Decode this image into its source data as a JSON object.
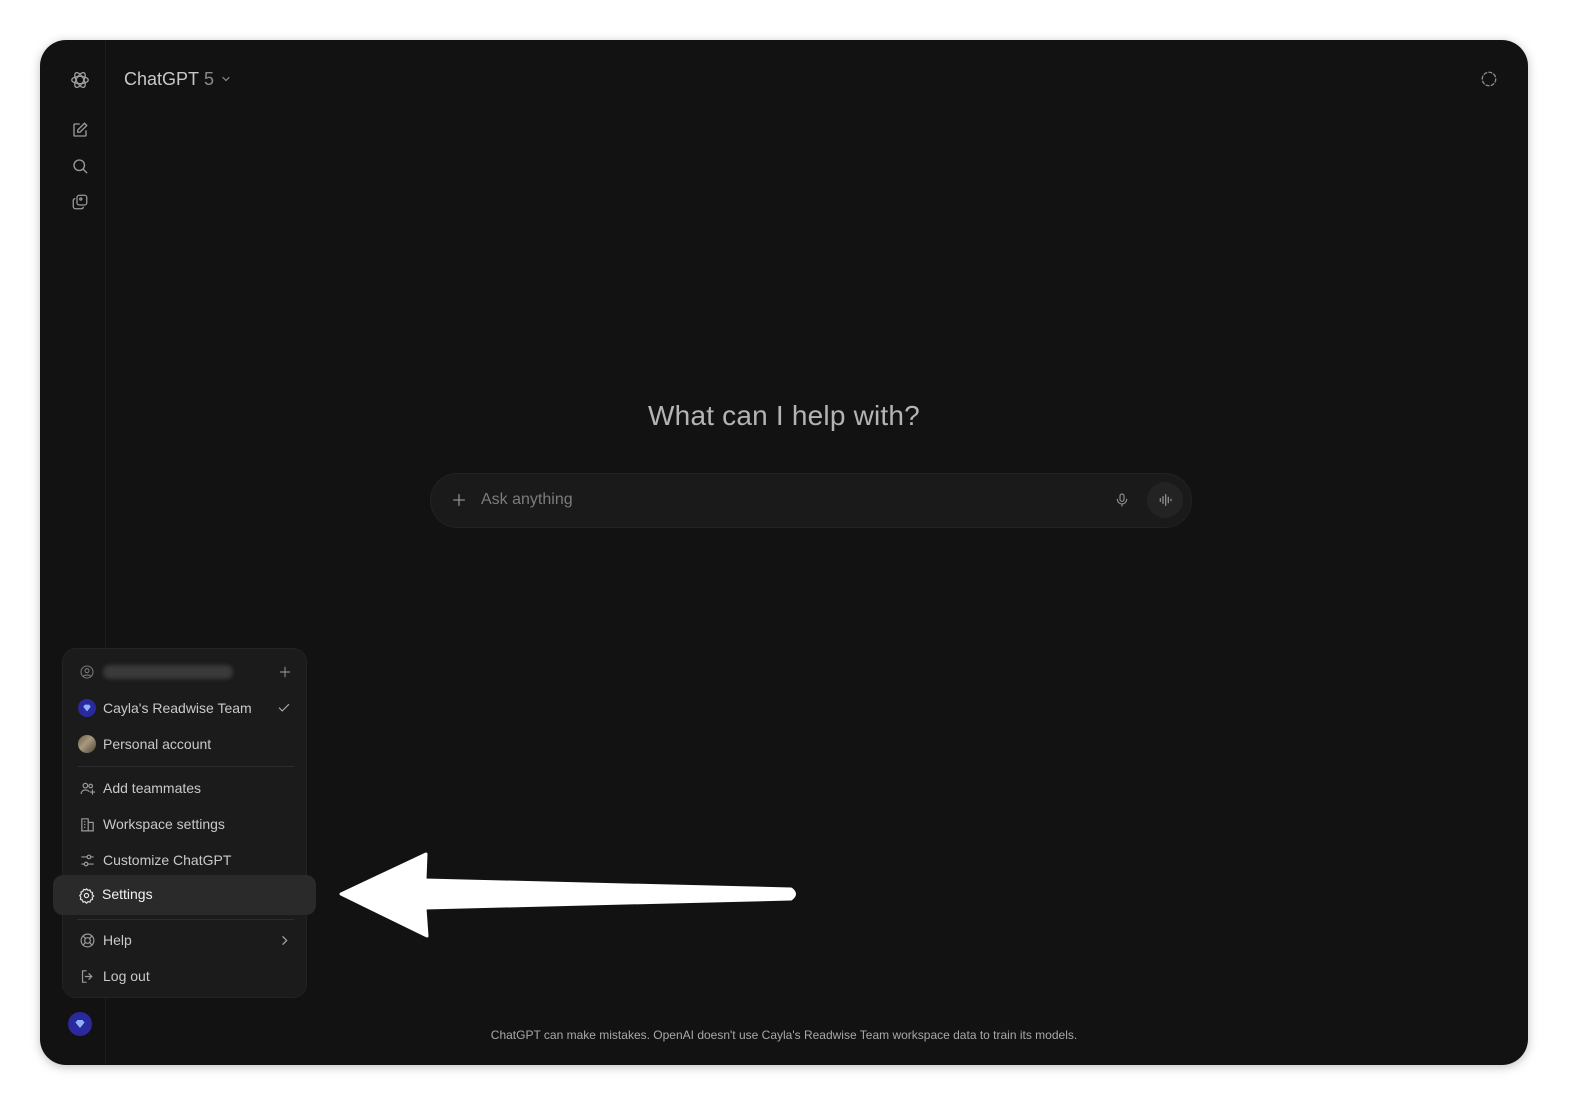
{
  "header": {
    "model_name": "ChatGPT",
    "model_version": "5"
  },
  "sidebar_rail": {
    "icons": [
      "openai-logo-icon",
      "new-chat-icon",
      "search-icon",
      "gallery-icon"
    ]
  },
  "main": {
    "headline": "What can I help with?",
    "composer": {
      "placeholder": "Ask anything",
      "icons": [
        "plus-icon",
        "microphone-icon",
        "voice-mode-icon"
      ]
    },
    "footer_note": "ChatGPT can make mistakes. OpenAI doesn't use Cayla's Readwise Team workspace data to train its models."
  },
  "account_menu": {
    "workspaces": [
      {
        "label": "Cayla's Readwise Team",
        "selected": true
      },
      {
        "label": "Personal account",
        "selected": false
      }
    ],
    "items": [
      {
        "label": "Add teammates",
        "icon": "add-people-icon"
      },
      {
        "label": "Workspace settings",
        "icon": "building-icon"
      },
      {
        "label": "Customize ChatGPT",
        "icon": "sliders-icon"
      },
      {
        "label": "Settings",
        "icon": "gear-icon",
        "highlighted": true
      },
      {
        "label": "Help",
        "icon": "lifebuoy-icon",
        "has_submenu": true
      },
      {
        "label": "Log out",
        "icon": "logout-icon"
      }
    ]
  },
  "colors": {
    "window_bg": "#121212",
    "menu_bg": "#1b1b1b",
    "workspace_avatar": "#2a2a9e",
    "annotation_arrow": "#ffffff"
  }
}
